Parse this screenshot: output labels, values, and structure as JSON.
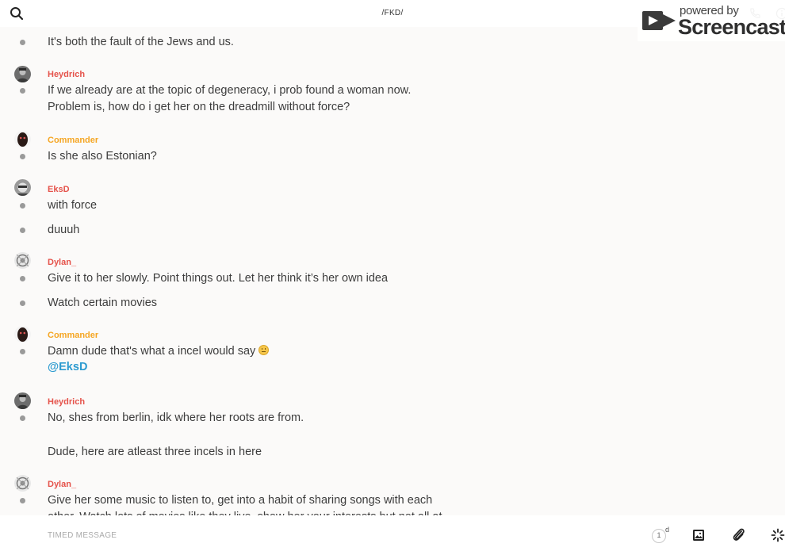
{
  "header": {
    "channel_title": "/FKD/"
  },
  "watermark": {
    "line1": "powered by",
    "line2": "Screencastify"
  },
  "messages": [
    {
      "type": "text",
      "text": "It's both the fault of the Jews and us."
    },
    {
      "type": "author",
      "name": "Heydrich",
      "color": "#e5534b"
    },
    {
      "type": "text",
      "text": "If we already are at the topic of degeneracy, i prob found a woman now."
    },
    {
      "type": "text",
      "text": "Problem is, how do i get her on the dreadmill without force?"
    },
    {
      "type": "author",
      "name": "Commander",
      "color": "#f5a623"
    },
    {
      "type": "text",
      "text": "Is she also Estonian?"
    },
    {
      "type": "author",
      "name": "EksD",
      "color": "#e5534b"
    },
    {
      "type": "text",
      "text": "with force"
    },
    {
      "type": "text",
      "text": "duuuh"
    },
    {
      "type": "author",
      "name": "Dylan_",
      "color": "#e5534b"
    },
    {
      "type": "text",
      "text": "Give it to her slowly. Point things out. Let her think it’s her own idea"
    },
    {
      "type": "text",
      "text": "Watch certain movies"
    },
    {
      "type": "author",
      "name": "Commander",
      "color": "#f5a623"
    },
    {
      "type": "text",
      "text": "Damn dude that's what a incel would say"
    },
    {
      "type": "mention",
      "text": "@EksD"
    },
    {
      "type": "author",
      "name": "Heydrich",
      "color": "#e5534b"
    },
    {
      "type": "text",
      "text": "No, shes from berlin, idk where her roots are from."
    },
    {
      "type": "text",
      "text": "Dude, here are atleast three incels in here"
    },
    {
      "type": "author",
      "name": "Dylan_",
      "color": "#e5534b"
    },
    {
      "type": "text",
      "text": "Give her some music to listen to, get into a habit of sharing songs with each"
    },
    {
      "type": "text",
      "text": "other. Watch lots of movies like they live, show her your interests but not all at"
    }
  ],
  "composer": {
    "placeholder": "TIMED MESSAGE",
    "timer_value": "1",
    "timer_unit": "d"
  },
  "icons": {
    "search": "search-icon",
    "phone": "phone-icon",
    "info": "info-icon",
    "image": "image-icon",
    "attach": "paperclip-icon",
    "more": "spinner-icon",
    "emoji": "upside-down-face-emoji"
  }
}
